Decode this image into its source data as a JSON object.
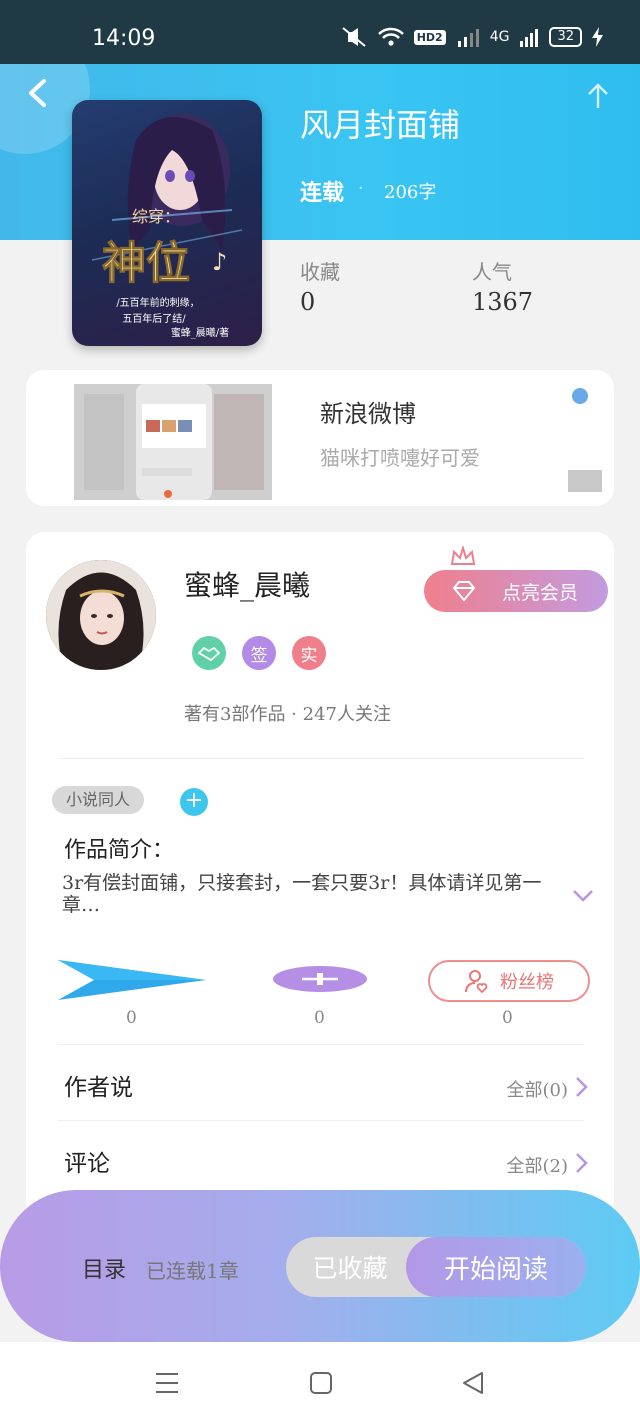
{
  "status_bar": {
    "time": "14:09",
    "network": "4G",
    "hd": "HD2",
    "battery": "32"
  },
  "book": {
    "title": "风月封面铺",
    "status": "连载",
    "dot": "·",
    "word_count": "206字",
    "cover_text": {
      "line1": "综穿：",
      "line2": "神位",
      "line3": "/五百年前的刺缘，",
      "line4": "五百年后了结/",
      "line5": "蜜蜂_晨曦/著"
    },
    "stats": [
      {
        "label": "收藏",
        "value": "0"
      },
      {
        "label": "人气",
        "value": "1367"
      }
    ]
  },
  "ad": {
    "title": "新浪微博",
    "desc": "猫咪打喷嚏好可爱"
  },
  "author": {
    "name": "蜜蜂_晨曦",
    "badges": [
      "签",
      "实"
    ],
    "meta": "著有3部作品 · 247人关注",
    "member_button": "点亮会员"
  },
  "work": {
    "tag": "小说同人",
    "tag_add": "+",
    "intro_label": "作品简介：",
    "intro_text": "3r有偿封面铺，只接套封，一套只要3r！具体请详见第一章…"
  },
  "actions": {
    "counts": [
      "0",
      "0",
      "0"
    ],
    "fans_label": "粉丝榜"
  },
  "sections": [
    {
      "label": "作者说",
      "link": "全部(0)"
    },
    {
      "label": "评论",
      "link": "全部(2)"
    }
  ],
  "bottom": {
    "toc_label": "目录",
    "toc_count": "已连载1章",
    "collected": "已收藏",
    "read": "开始阅读"
  },
  "colors": {
    "header": "#39c5f2",
    "accent_pink": "#f07f8c",
    "accent_purple": "#c39be0"
  }
}
